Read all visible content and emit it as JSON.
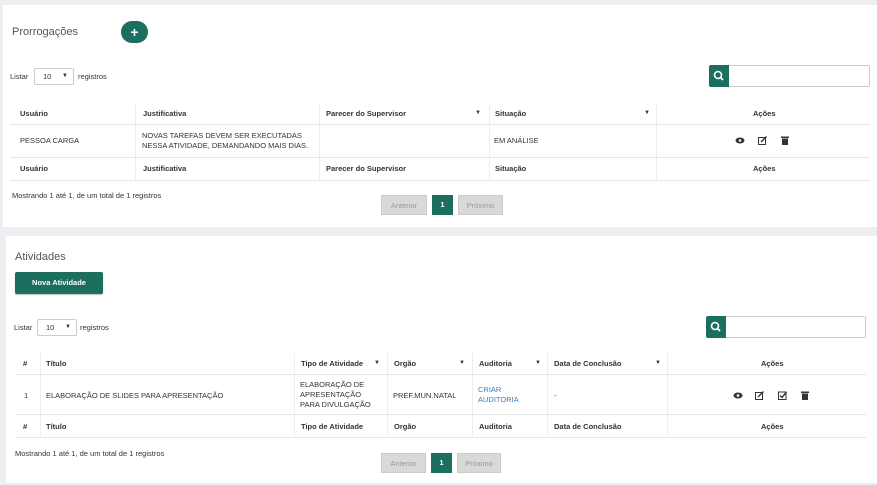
{
  "prorrogacoes": {
    "title": "Prorrogações",
    "add_label": "+",
    "listar": "Listar",
    "page_size": "10",
    "registros": "registros",
    "headers": [
      "Usuário",
      "Justificativa",
      "Parecer do Supervisor",
      "Situação",
      "Ações"
    ],
    "row": {
      "usuario": "PESSOA CARGA",
      "justificativa_l1": "NOVAS TAREFAS DEVEM SER EXECUTADAS",
      "justificativa_l2": "NESSA ATIVIDADE, DEMANDANDO MAIS DIAS.",
      "parecer": "",
      "situacao": "EM ANÁLISE"
    },
    "info": "Mostrando 1 até 1, de um total de 1 registros",
    "pagination": {
      "prev": "Anterior",
      "current": "1",
      "next": "Próximo"
    }
  },
  "atividades": {
    "title": "Atividades",
    "nova_label": "Nova Atividade",
    "listar": "Listar",
    "page_size": "10",
    "registros": "registros",
    "headers": [
      "#",
      "Título",
      "Tipo de Atividade",
      "Orgão",
      "Auditoria",
      "Data de Conclusão",
      "Ações"
    ],
    "row": {
      "num": "1",
      "titulo": "ELABORAÇÃO DE SLIDES PARA APRESENTAÇÃO",
      "tipo_l1": "ELABORAÇÃO DE",
      "tipo_l2": "APRESENTAÇÃO",
      "tipo_l3": "PARA DIVULGAÇÃO",
      "orgao": "PREF.MUN.NATAL",
      "auditoria_l1": "CRIAR",
      "auditoria_l2": "AUDITORIA",
      "data": "-"
    },
    "info": "Mostrando 1 até 1, de um total de 1 registros",
    "pagination": {
      "prev": "Anterior",
      "current": "1",
      "next": "Próximo"
    }
  },
  "colors": {
    "accent": "#1c6e5f",
    "link": "#3a7bbf"
  }
}
